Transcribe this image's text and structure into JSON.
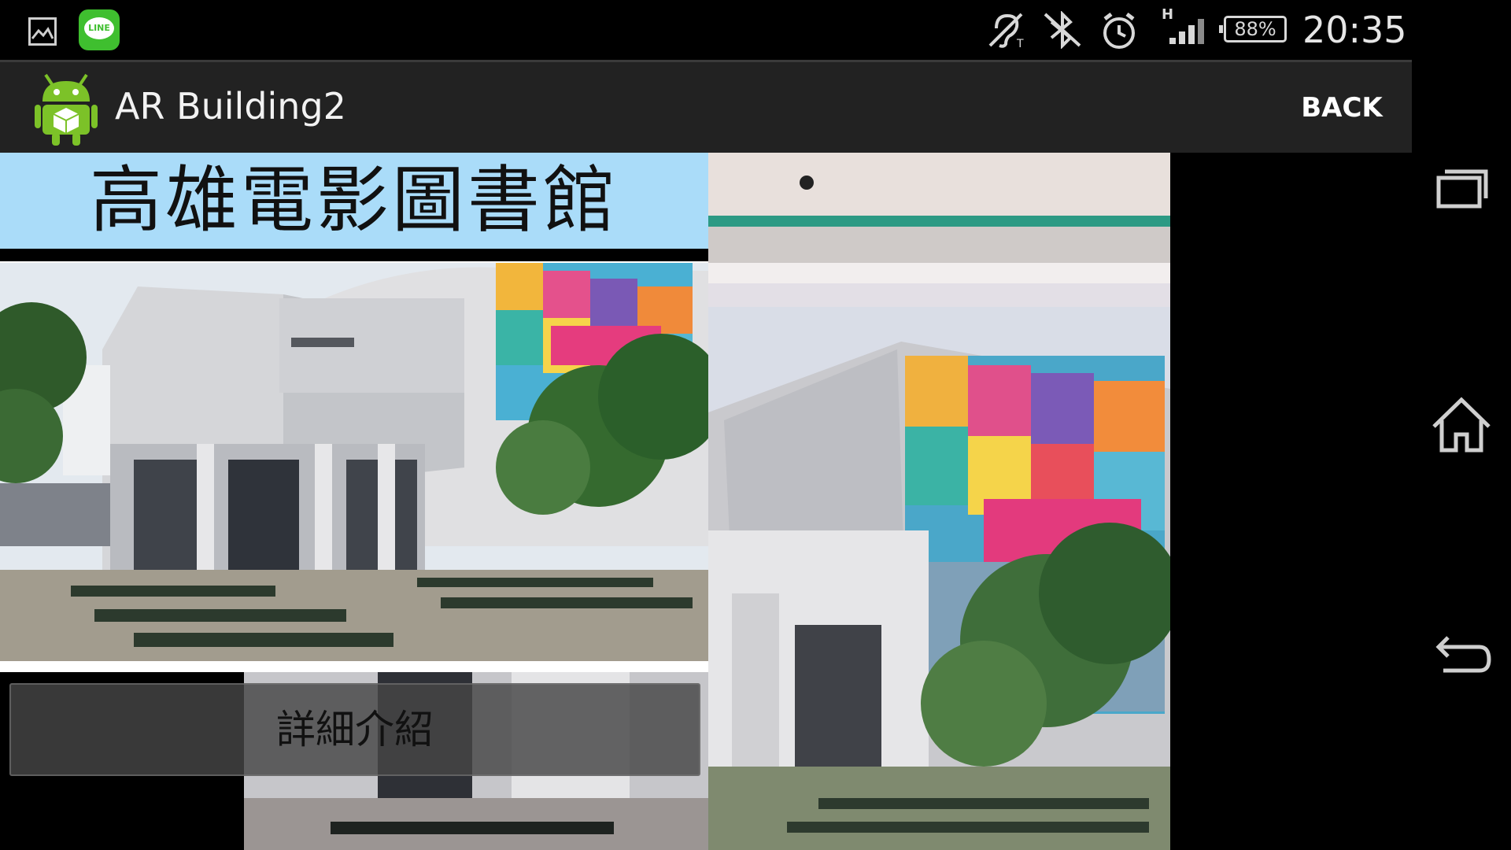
{
  "status_bar": {
    "left_icons": [
      "gallery-icon",
      "line-app-icon"
    ],
    "line_label": "LINE",
    "right_icons": [
      "hearing-aid-icon",
      "bluetooth-off-icon",
      "alarm-icon",
      "signal-icon"
    ],
    "network_type": "H",
    "battery_percent": "88%",
    "time": "20:35"
  },
  "action_bar": {
    "app_title": "AR Building2",
    "back_label": "BACK"
  },
  "info_panel": {
    "title": "高雄電影圖書館",
    "detail_button_label": "詳細介紹"
  },
  "nav_bar": {
    "icons": [
      "recent-apps-icon",
      "home-icon",
      "back-icon"
    ]
  },
  "colors": {
    "title_panel_bg": "#aadcf9",
    "action_bar_bg": "#222222",
    "line_green": "#3fbf2f",
    "android_green": "#7cc228"
  }
}
